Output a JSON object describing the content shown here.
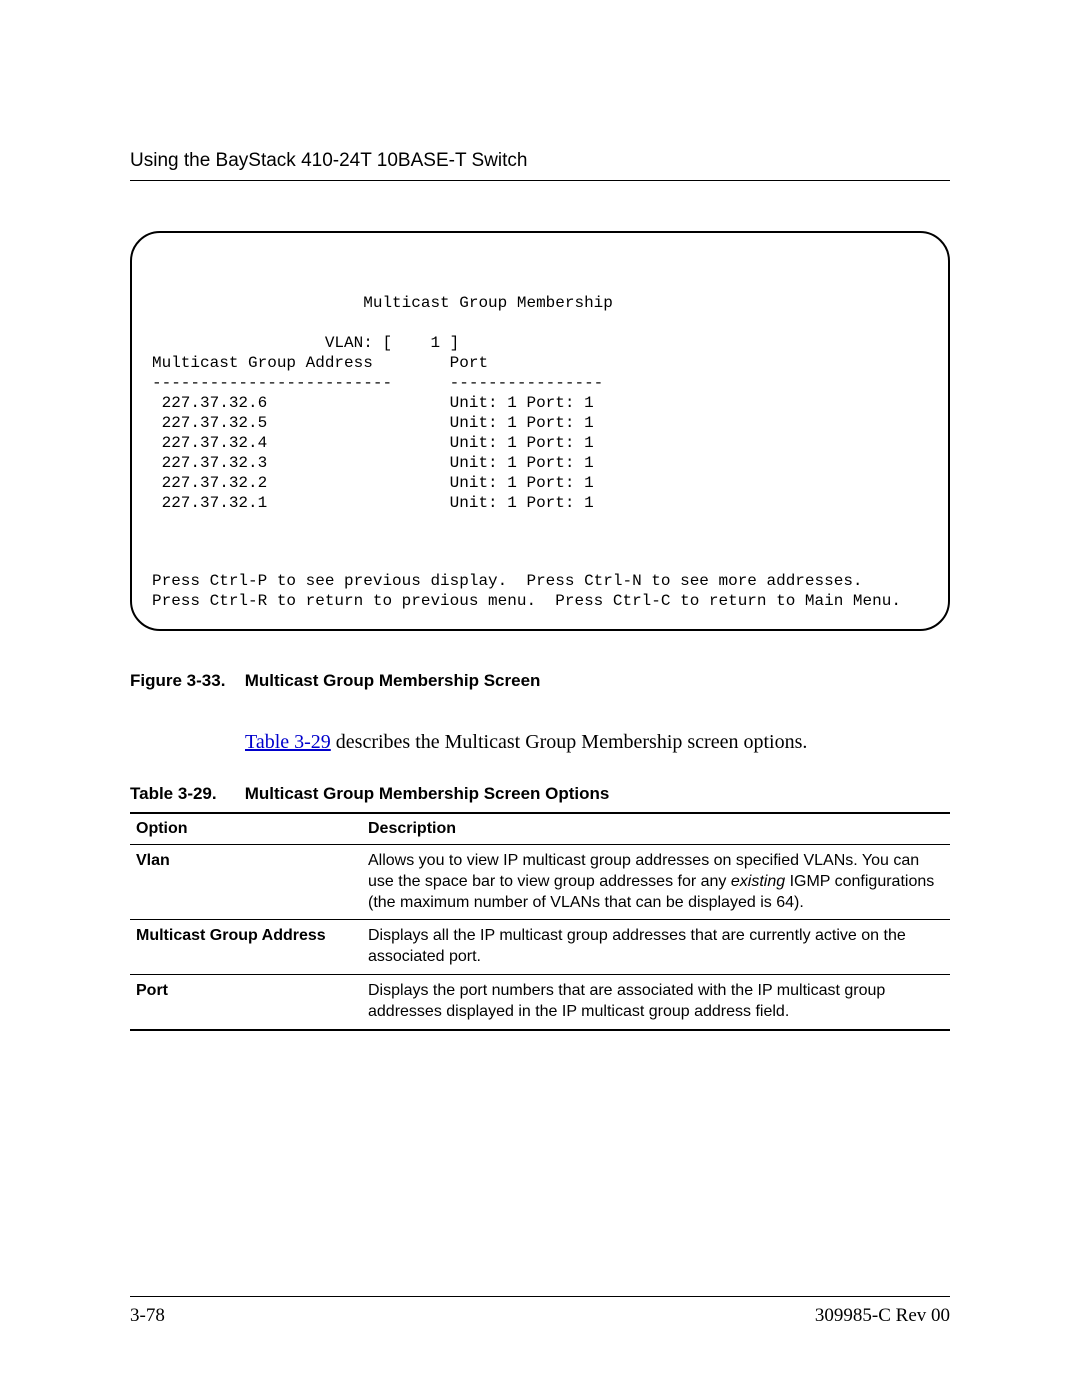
{
  "header": {
    "title": "Using the BayStack 410-24T 10BASE-T Switch"
  },
  "terminal": {
    "title": "Multicast Group Membership",
    "vlan_label": "VLAN: [    1 ]",
    "col1": "Multicast Group Address",
    "col2": "Port",
    "sep1": "-------------------------",
    "sep2": "----------------",
    "rows": [
      {
        "addr": "227.37.32.6",
        "port": "Unit: 1 Port: 1"
      },
      {
        "addr": "227.37.32.5",
        "port": "Unit: 1 Port: 1"
      },
      {
        "addr": "227.37.32.4",
        "port": "Unit: 1 Port: 1"
      },
      {
        "addr": "227.37.32.3",
        "port": "Unit: 1 Port: 1"
      },
      {
        "addr": "227.37.32.2",
        "port": "Unit: 1 Port: 1"
      },
      {
        "addr": "227.37.32.1",
        "port": "Unit: 1 Port: 1"
      }
    ],
    "hint1": "Press Ctrl-P to see previous display.  Press Ctrl-N to see more addresses.",
    "hint2": "Press Ctrl-R to return to previous menu.  Press Ctrl-C to return to Main Menu."
  },
  "figure": {
    "label": "Figure 3-33.",
    "title": "Multicast Group Membership Screen"
  },
  "body": {
    "link_text": "Table 3-29",
    "rest": " describes the Multicast Group Membership screen options."
  },
  "table_caption": {
    "label": "Table 3-29.",
    "title": "Multicast Group Membership Screen Options"
  },
  "table": {
    "head_option": "Option",
    "head_desc": "Description",
    "rows": [
      {
        "option": "Vlan",
        "desc_pre": "Allows you to view IP multicast group addresses on specified VLANs. You can use the space bar to view group addresses for any ",
        "desc_em": "existing",
        "desc_post": " IGMP configurations (the maximum number of VLANs that can be displayed is 64)."
      },
      {
        "option": "Multicast Group Address",
        "desc_pre": "Displays all the IP multicast group addresses that are currently active on the associated port.",
        "desc_em": "",
        "desc_post": ""
      },
      {
        "option": "Port",
        "desc_pre": "Displays the port numbers that are associated with the IP multicast group addresses displayed in the IP multicast group address field.",
        "desc_em": "",
        "desc_post": ""
      }
    ]
  },
  "footer": {
    "page": "3-78",
    "doc": "309985-C Rev 00"
  }
}
